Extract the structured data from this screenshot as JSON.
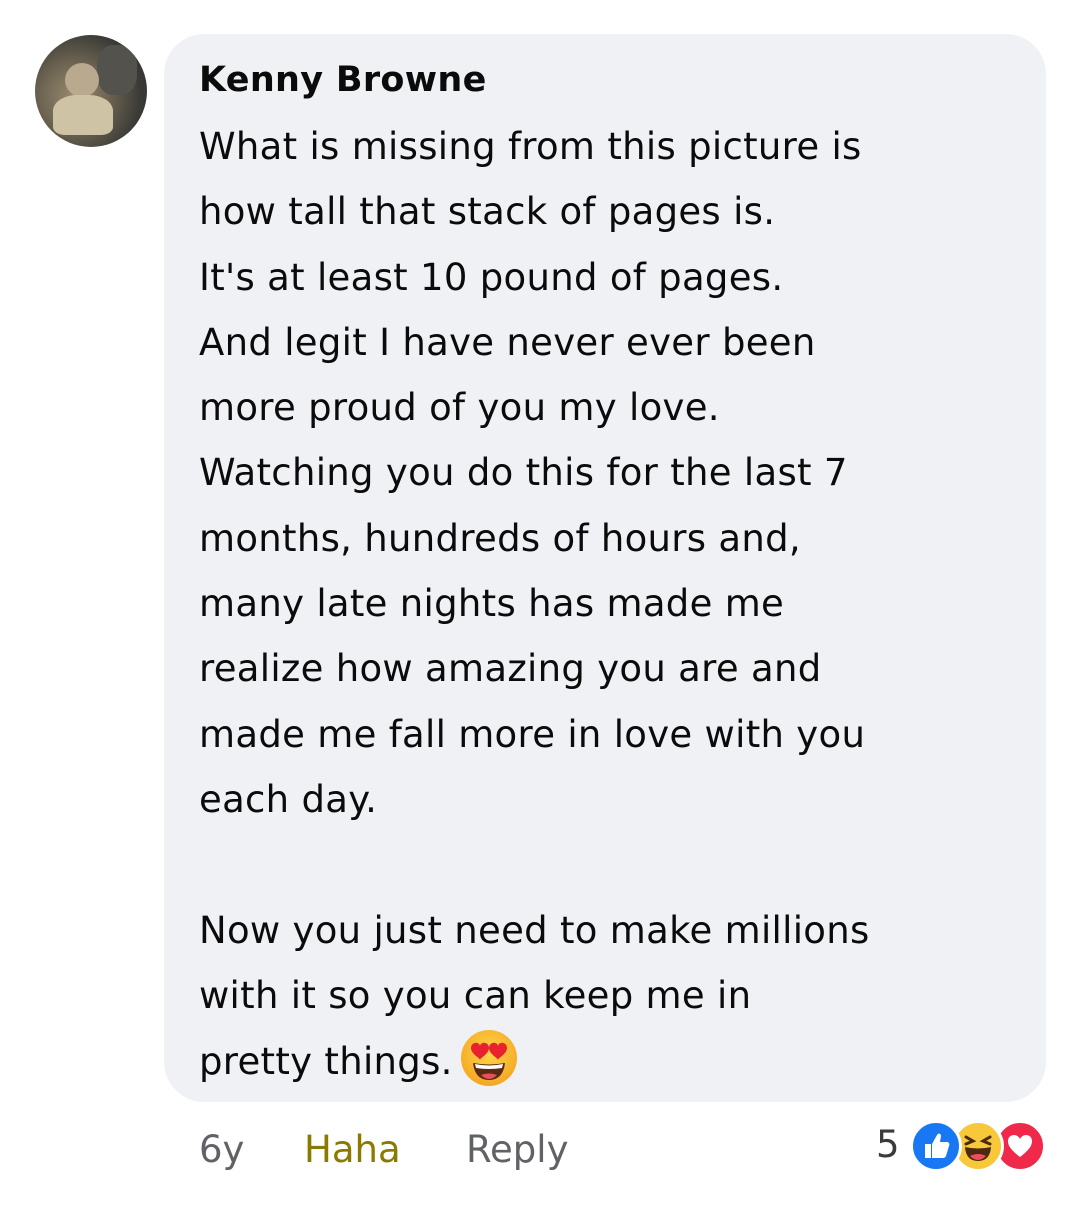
{
  "comment": {
    "author": "Kenny Browne",
    "lines": [
      "What is missing from this picture is",
      "how tall that stack of pages is.",
      "It's at least 10 pound of pages.",
      "And legit I have never ever been",
      "more proud of you my love.",
      "Watching you do this for the last 7",
      "months, hundreds of hours and,",
      "many late nights has made me",
      "realize how amazing you are and",
      "made me fall more in love with you",
      "each day."
    ],
    "lines2": [
      "Now you just need to make millions",
      "with it so you can keep me in",
      "pretty things."
    ],
    "inline_emoji": "heart-eyes-emoji"
  },
  "footer": {
    "time": "6y",
    "reaction_label": "Haha",
    "reply_label": "Reply",
    "reaction_count": "5"
  },
  "reactions": [
    "like-icon",
    "haha-icon",
    "love-icon"
  ],
  "colors": {
    "bubble": "#f0f1f5",
    "haha_label": "#8a7a00",
    "like": "#1877f2",
    "haha": "#f7c83a",
    "love": "#f0284a"
  }
}
